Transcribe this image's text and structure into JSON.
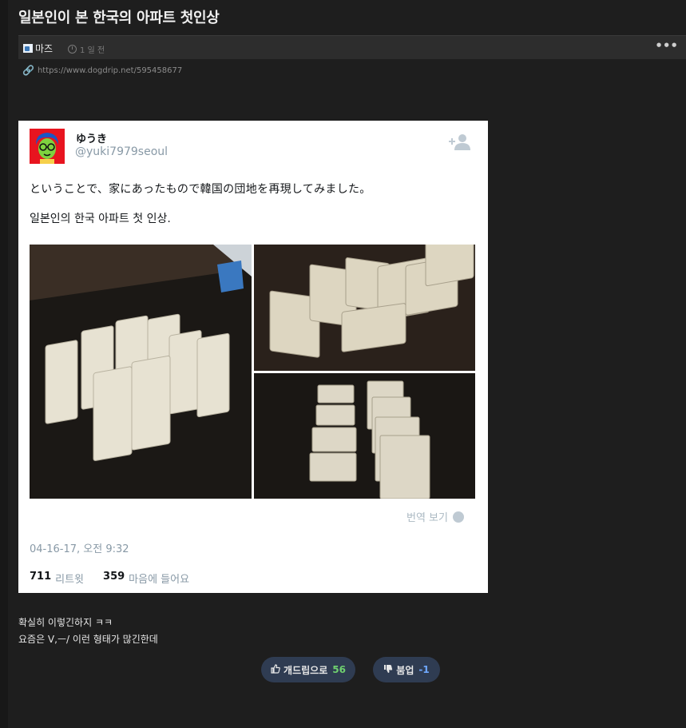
{
  "post": {
    "title": "일본인이 본 한국의 아파트 첫인상",
    "author": "마즈",
    "time": "1 일 전",
    "link": "https://www.dogdrip.net/595458677",
    "more": "•••"
  },
  "tweet": {
    "display_name": "ゆうき",
    "handle": "@yuki7979seoul",
    "text_jp": "ということで、家にあったもので韓国の団地を再現してみました。",
    "text_ko": "일본인의 한국 아파트 첫 인상.",
    "translate": "번역 보기",
    "date": "04-16-17, 오전 9:32",
    "retweet_count": "711",
    "retweet_label": "리트윗",
    "like_count": "359",
    "like_label": "마음에 들어요"
  },
  "comment": {
    "line1": "확실히 이렇긴하지 ㅋㅋ",
    "line2": "요즘은 V,ㅡ/ 이런 형태가 많긴한데"
  },
  "votes": {
    "up_label": "개드립으로",
    "up_count": "56",
    "down_label": "붐업",
    "down_count": "-1"
  },
  "colors": {
    "background": "#1e1e1e",
    "metabar": "#2d2d2d",
    "vote_button": "#2f3c52",
    "up_count": "#6fd06f",
    "down_count": "#6fa8ff",
    "twitter_gray": "#8899a6"
  },
  "icons": [
    "link-icon",
    "clock-icon",
    "more-icon",
    "follow-icon",
    "globe-icon",
    "thumbs-up-icon",
    "thumbs-down-icon"
  ]
}
